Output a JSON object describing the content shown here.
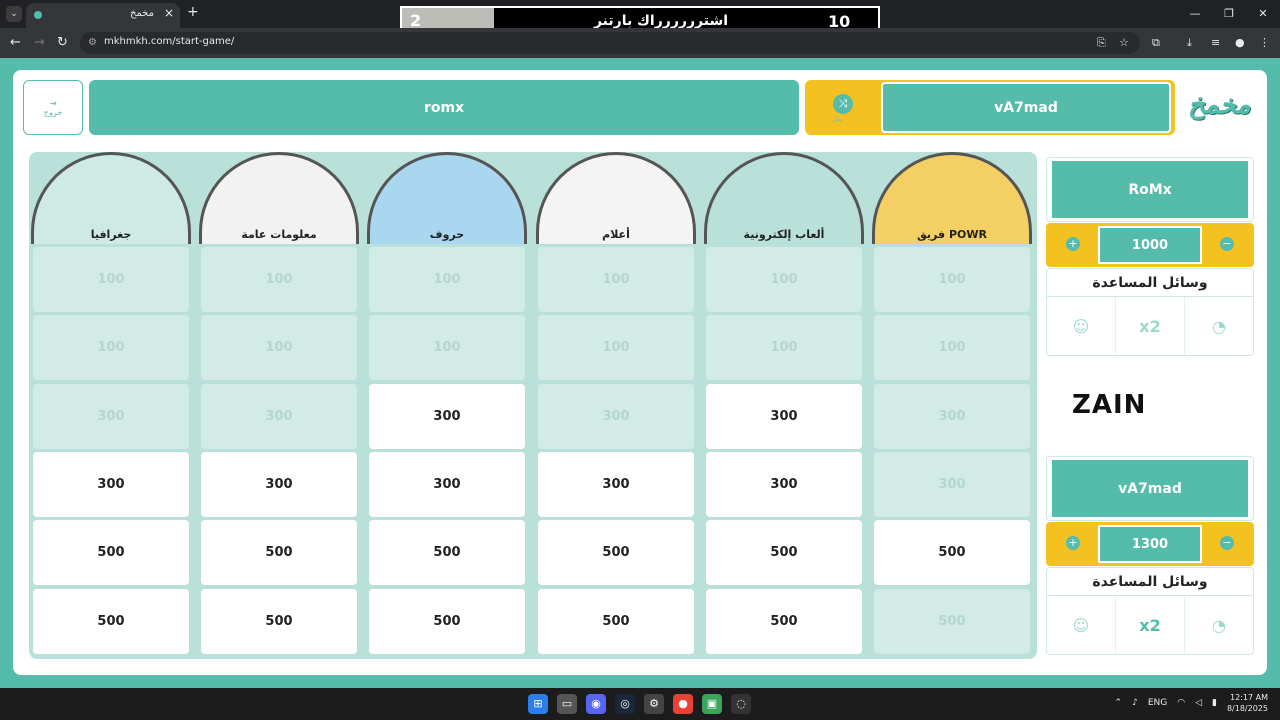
{
  "browser": {
    "tab_title": "مخمخ",
    "url": "mkhmkh.com/start-game/"
  },
  "banner": {
    "left_score": "2",
    "title": "اشترررررراك بارتنر",
    "right_score": "10"
  },
  "header": {
    "exit_label": "خروج",
    "team_left": "romx",
    "turn_team": "vA7mad",
    "turn_sub": "بدل"
  },
  "categories": [
    {
      "label": "جغرافيا"
    },
    {
      "label": "معلومات عامة"
    },
    {
      "label": "حروف"
    },
    {
      "label": "أعلام"
    },
    {
      "label": "ألعاب إلكترونية"
    },
    {
      "label": "فريق POWR"
    }
  ],
  "board": {
    "rows": [
      {
        "value": "100",
        "states": [
          "used",
          "used",
          "used",
          "used",
          "used",
          "used"
        ]
      },
      {
        "value": "100",
        "states": [
          "used",
          "used",
          "used",
          "used",
          "used",
          "used"
        ]
      },
      {
        "value": "300",
        "states": [
          "used",
          "used",
          "open",
          "used",
          "open",
          "used"
        ]
      },
      {
        "value": "300",
        "states": [
          "open",
          "open",
          "open",
          "open",
          "open",
          "used"
        ]
      },
      {
        "value": "500",
        "states": [
          "open",
          "open",
          "open",
          "open",
          "open",
          "open"
        ]
      },
      {
        "value": "500",
        "states": [
          "open",
          "open",
          "open",
          "open",
          "open",
          "used"
        ]
      }
    ]
  },
  "teams": [
    {
      "name": "RoMx",
      "score": "1000",
      "aids_title": "وسائل المساعدة",
      "x2": "x2"
    },
    {
      "name": "vA7mad",
      "score": "1300",
      "aids_title": "وسائل المساعدة",
      "x2": "x2"
    }
  ],
  "sponsor": "ZAIN",
  "taskbar": {
    "lang": "ENG",
    "time": "12:17 AM",
    "date": "8/18/2025"
  }
}
